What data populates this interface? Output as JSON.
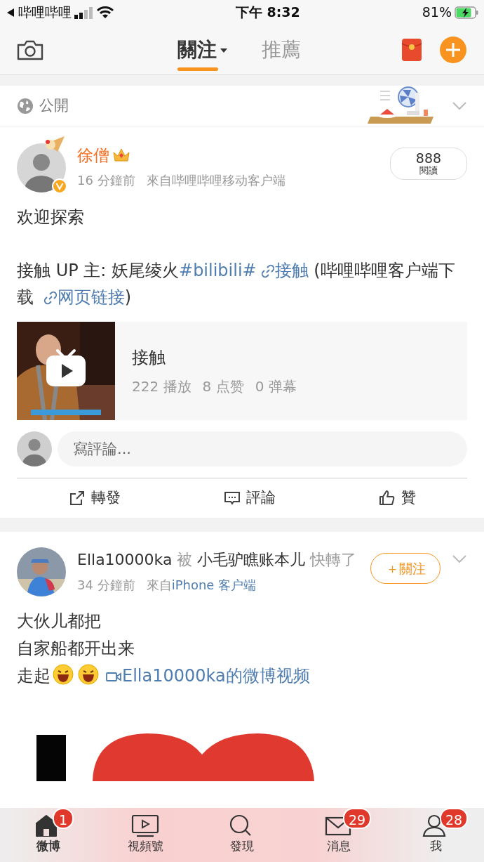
{
  "status_bar": {
    "back_app": "哔哩哔哩",
    "time": "下午 8:32",
    "battery": "81%",
    "charging": true
  },
  "top_nav": {
    "tabs": [
      {
        "label": "關注",
        "selected": true,
        "dropdown": true
      },
      {
        "label": "推薦",
        "selected": false,
        "dropdown": false
      }
    ]
  },
  "visibility": {
    "label": "公開"
  },
  "posts": [
    {
      "author": "徐僧",
      "vip": true,
      "verified": true,
      "time": "16 分鐘前",
      "source_prefix": "來自",
      "source": "哔哩哔哩移动客户端",
      "source_link": false,
      "reads": {
        "count": "888",
        "label": "閱讀"
      },
      "paragraphs": [
        [
          {
            "kind": "text",
            "text": "欢迎探索"
          }
        ],
        [
          {
            "kind": "text",
            "text": "接触 UP 主: 妖尾绫火"
          },
          {
            "kind": "topic",
            "text": "#bilibili#"
          },
          {
            "kind": "link",
            "text": "接触"
          },
          {
            "kind": "text",
            "text": " (哔哩哔哩客户端下载 "
          },
          {
            "kind": "link",
            "text": "网页链接"
          },
          {
            "kind": "text",
            "text": ")"
          }
        ]
      ],
      "video_card": {
        "title": "接触",
        "stats": [
          "222 播放",
          "8 点赞",
          "0 弹幕"
        ]
      },
      "comment_box": {
        "placeholder": "寫評論..."
      },
      "actions": [
        {
          "kind": "repost",
          "label": "轉發"
        },
        {
          "kind": "comment",
          "label": "評論"
        },
        {
          "kind": "like",
          "label": "贊"
        }
      ]
    },
    {
      "header": [
        {
          "kind": "name",
          "text": "Ella10000ka"
        },
        {
          "kind": "plain",
          "text": " 被 "
        },
        {
          "kind": "name",
          "text": "小毛驴瞧账本儿"
        },
        {
          "kind": "plain",
          "text": " 快轉了"
        }
      ],
      "follow_button": "＋關注",
      "time": "34 分鐘前",
      "source_prefix": "來自",
      "source": "iPhone 客户端",
      "source_link": true,
      "lines": [
        [
          {
            "kind": "text",
            "text": "大伙儿都把"
          }
        ],
        [
          {
            "kind": "text",
            "text": "自家船都开出来"
          }
        ],
        [
          {
            "kind": "text",
            "text": "走起"
          },
          {
            "kind": "emoji"
          },
          {
            "kind": "emoji"
          },
          {
            "kind": "video_link",
            "text": "Ella10000ka的微博视频"
          }
        ]
      ],
      "image": {
        "kind": "picture"
      }
    }
  ],
  "tab_bar": [
    {
      "label": "微博",
      "kind": "home",
      "badge": "1",
      "selected": true
    },
    {
      "label": "視頻號",
      "kind": "video",
      "selected": false
    },
    {
      "label": "發現",
      "kind": "search",
      "selected": false
    },
    {
      "label": "消息",
      "kind": "mail",
      "badge": "29",
      "selected": false
    },
    {
      "label": "我",
      "kind": "person",
      "badge": "28",
      "selected": false
    }
  ]
}
